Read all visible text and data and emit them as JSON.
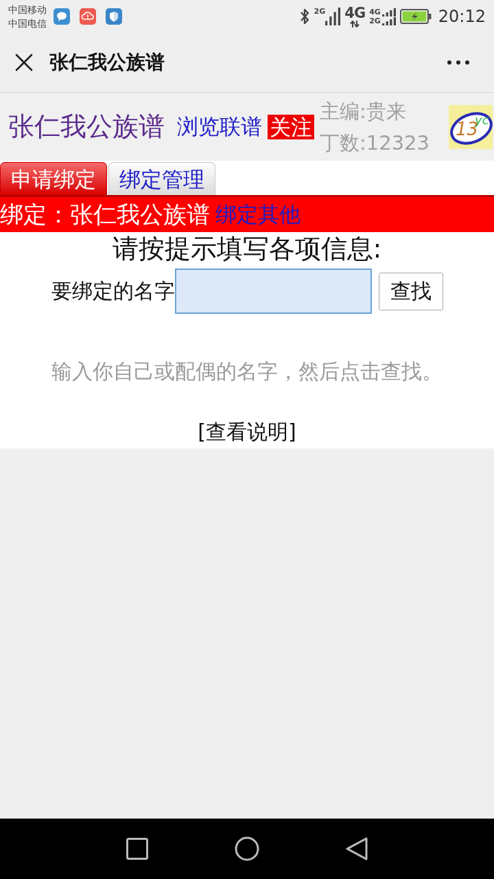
{
  "status_bar": {
    "carriers": [
      "中国移动",
      "中国电信"
    ],
    "sim1_network": "2G",
    "data_network": "4G",
    "sim2_networks": [
      "4G",
      "2G"
    ],
    "time": "20:12"
  },
  "app_bar": {
    "title": "张仁我公族谱"
  },
  "header": {
    "title": "张仁我公族谱",
    "browse_link": "浏览联谱",
    "follow_button": "关注",
    "editor": "主编:贵来",
    "member_count": "丁数:12323",
    "logo": {
      "number": "13",
      "letters": "yc"
    }
  },
  "tabs": [
    {
      "label": "申请绑定",
      "selected": true
    },
    {
      "label": "绑定管理",
      "selected": false
    }
  ],
  "binding_bar": {
    "label": "绑定：张仁我公族谱",
    "link": "绑定其他"
  },
  "form": {
    "heading": "请按提示填写各项信息:",
    "name_label": "要绑定的名字",
    "search_button": "查找",
    "hint": "输入你自己或配偶的名字，然后点击查找。",
    "help_link": "[查看说明]"
  }
}
